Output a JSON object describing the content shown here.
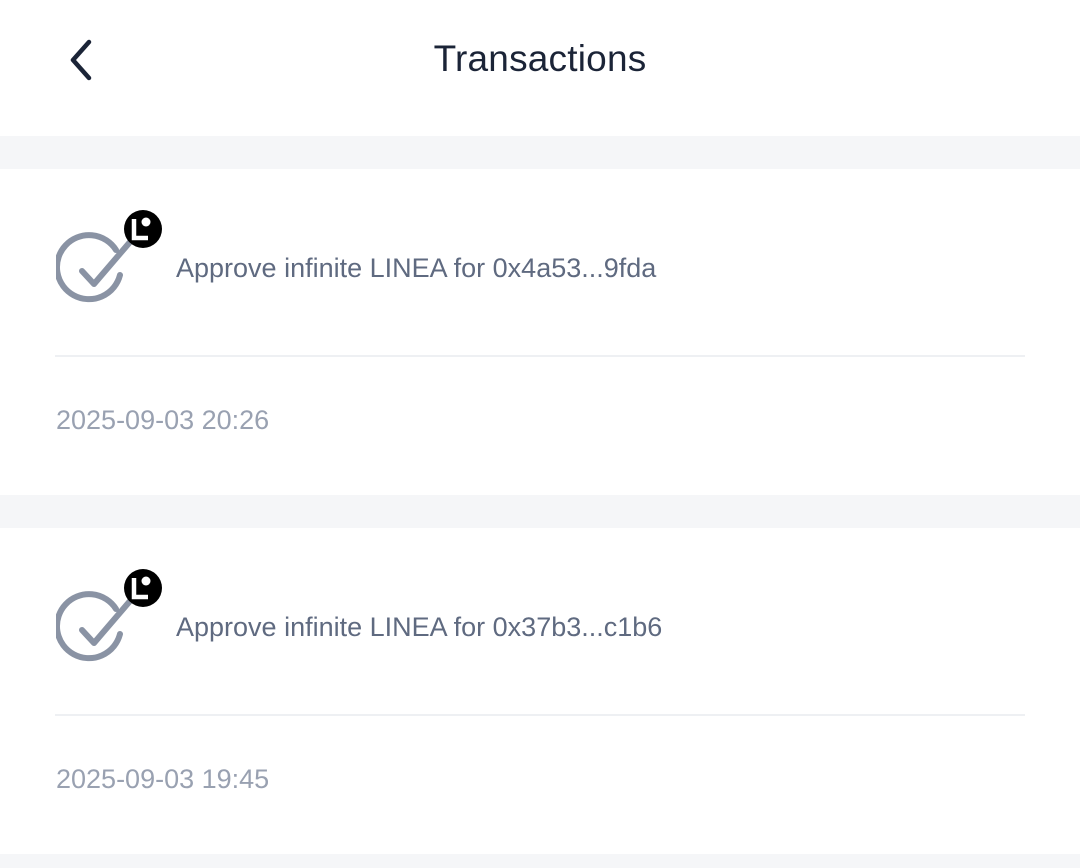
{
  "header": {
    "title": "Transactions",
    "back_icon": "chevron-left-icon"
  },
  "transactions": [
    {
      "label": "Approve infinite LINEA for 0x4a53...9fda",
      "date": "2025-09-03 20:26",
      "status_icon": "check-circle-icon",
      "token_badge_icon": "linea-token-icon"
    },
    {
      "label": "Approve infinite LINEA for 0x37b3...c1b6",
      "date": "2025-09-03 19:45",
      "status_icon": "check-circle-icon",
      "token_badge_icon": "linea-token-icon"
    }
  ],
  "colors": {
    "title": "#1b2437",
    "label": "#5f6a80",
    "date": "#99a1b1",
    "icon": "#8a93a4",
    "separator": "#f5f6f8",
    "badge": "#000000"
  }
}
